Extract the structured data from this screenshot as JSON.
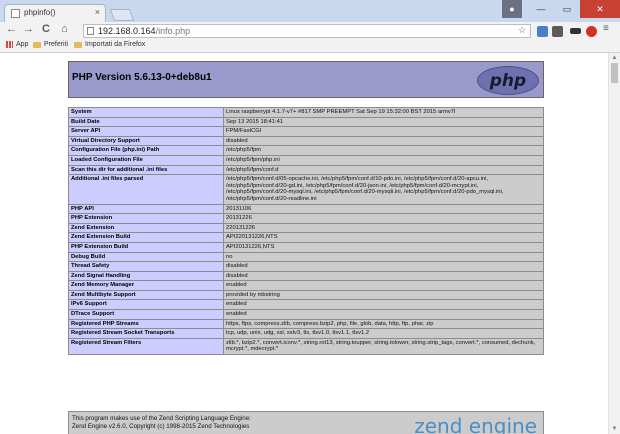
{
  "browser": {
    "tab_title": "phpinfo()",
    "tab_close": "×",
    "url_host": "192.168.0.164",
    "url_path": "/info.php",
    "url_tools": "☆",
    "back": "←",
    "forward": "→",
    "reload": "C",
    "home": "⌂"
  },
  "bookmarks": {
    "items": [
      "App",
      "Preferiti",
      "Importati da Firefox"
    ]
  },
  "page": {
    "php_version": "PHP Version 5.6.13-0+deb8u1",
    "logo_text": "php",
    "rows": [
      {
        "k": "System",
        "v": "Linux raspberrypi 4.1.7-v7+ #817 SMP PREEMPT Sat Sep 19 15:32:00 BST 2015 armv7l"
      },
      {
        "k": "Build Date",
        "v": "Sep 13 2015 18:41:41"
      },
      {
        "k": "Server API",
        "v": "FPM/FastCGI"
      },
      {
        "k": "Virtual Directory Support",
        "v": "disabled"
      },
      {
        "k": "Configuration File (php.ini) Path",
        "v": "/etc/php5/fpm"
      },
      {
        "k": "Loaded Configuration File",
        "v": "/etc/php5/fpm/php.ini"
      },
      {
        "k": "Scan this dir for additional .ini files",
        "v": "/etc/php5/fpm/conf.d"
      },
      {
        "k": "Additional .ini files parsed",
        "v": "/etc/php5/fpm/conf.d/05-opcache.ini, /etc/php5/fpm/conf.d/10-pdo.ini, /etc/php5/fpm/conf.d/20-apcu.ini, /etc/php5/fpm/conf.d/20-gd.ini, /etc/php5/fpm/conf.d/20-json.ini, /etc/php5/fpm/conf.d/20-mcrypt.ini, /etc/php5/fpm/conf.d/20-mysql.ini, /etc/php5/fpm/conf.d/20-mysqli.ini, /etc/php5/fpm/conf.d/20-pdo_mysql.ini, /etc/php5/fpm/conf.d/20-readline.ini"
      },
      {
        "k": "PHP API",
        "v": "20131106"
      },
      {
        "k": "PHP Extension",
        "v": "20131226"
      },
      {
        "k": "Zend Extension",
        "v": "220131226"
      },
      {
        "k": "Zend Extension Build",
        "v": "API220131226,NTS"
      },
      {
        "k": "PHP Extension Build",
        "v": "API20131226,NTS"
      },
      {
        "k": "Debug Build",
        "v": "no"
      },
      {
        "k": "Thread Safety",
        "v": "disabled"
      },
      {
        "k": "Zend Signal Handling",
        "v": "disabled"
      },
      {
        "k": "Zend Memory Manager",
        "v": "enabled"
      },
      {
        "k": "Zend Multibyte Support",
        "v": "provided by mbstring"
      },
      {
        "k": "IPv6 Support",
        "v": "enabled"
      },
      {
        "k": "DTrace Support",
        "v": "enabled"
      },
      {
        "k": "Registered PHP Streams",
        "v": "https, ftps, compress.zlib, compress.bzip2, php, file, glob, data, http, ftp, phar, zip"
      },
      {
        "k": "Registered Stream Socket Transports",
        "v": "tcp, udp, unix, udg, ssl, sslv3, tls, tlsv1.0, tlsv1.1, tlsv1.2"
      },
      {
        "k": "Registered Stream Filters",
        "v": "zlib.*, bzip2.*, convert.iconv.*, string.rot13, string.toupper, string.tolower, string.strip_tags, convert.*, consumed, dechunk, mcrypt.*, mdecrypt.*"
      }
    ],
    "zend_line1": "This program makes use of the Zend Scripting Language Engine:",
    "zend_line2": "Zend Engine v2.6.0, Copyright (c) 1998-2015 Zend Technologies",
    "zend_logo": "zend engine"
  }
}
